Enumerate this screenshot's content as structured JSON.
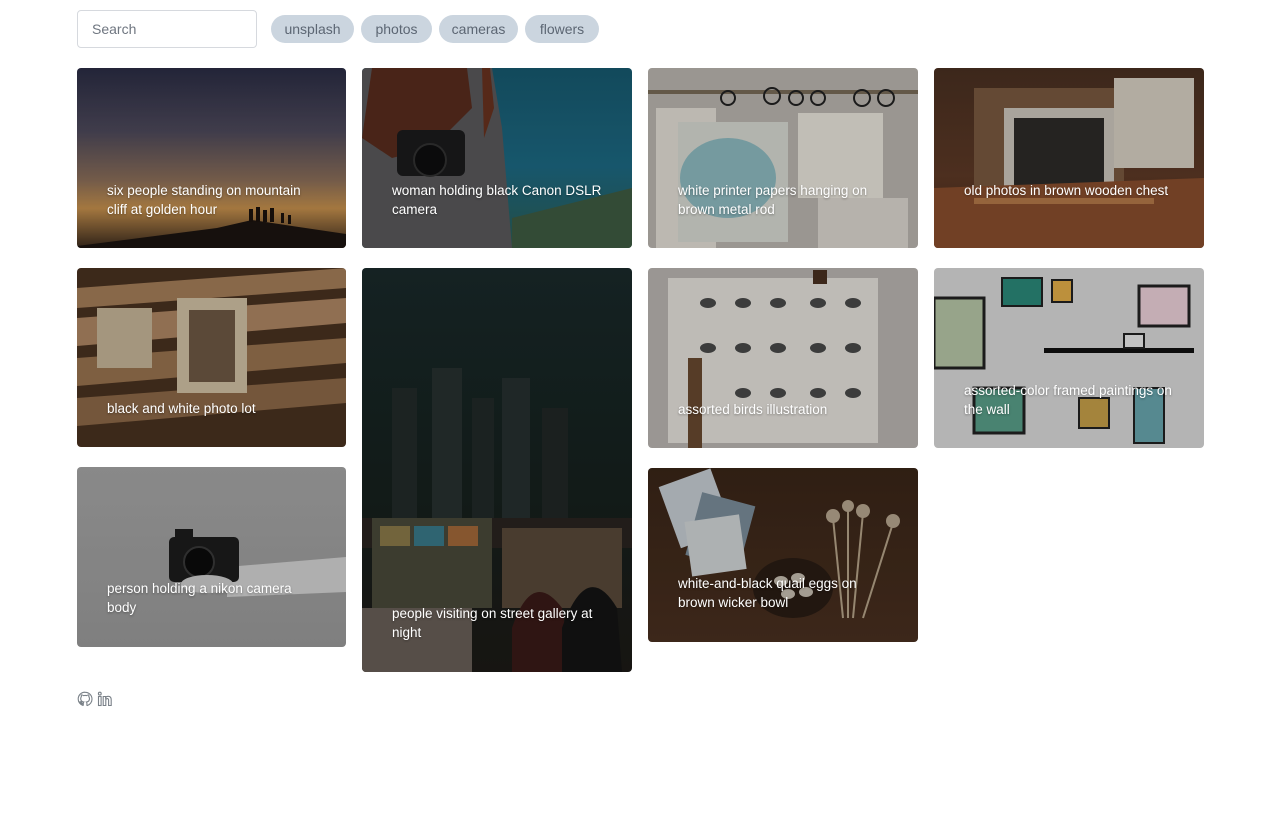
{
  "search": {
    "placeholder": "Search",
    "value": ""
  },
  "tags": [
    "unsplash",
    "photos",
    "cameras",
    "flowers"
  ],
  "photos": [
    {
      "caption": "six people standing on mountain cliff at golden hour"
    },
    {
      "caption": "woman holding black Canon DSLR camera"
    },
    {
      "caption": "white printer papers hanging on brown metal rod"
    },
    {
      "caption": "old photos in brown wooden chest"
    },
    {
      "caption": "black and white photo lot"
    },
    {
      "caption": "people visiting on street gallery at night"
    },
    {
      "caption": "assorted birds illustration"
    },
    {
      "caption": "assorted-color framed paintings on the wall"
    },
    {
      "caption": "person holding a nikon camera body"
    },
    {
      "caption": "white-and-black quail eggs on brown wicker bowl"
    }
  ],
  "footer": {
    "icons": [
      "github-icon",
      "linkedin-icon"
    ]
  }
}
